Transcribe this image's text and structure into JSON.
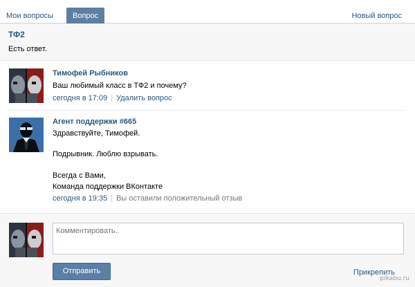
{
  "tabs": {
    "my_questions": "Мои вопросы",
    "question": "Вопрос",
    "new_question": "Новый вопрос"
  },
  "question": {
    "title": "ТФ2",
    "status": "Есть ответ."
  },
  "messages": [
    {
      "author": "Тимофей Рыбников",
      "text": "Ваш любимый класс в ТФ2 и почему?",
      "time": "сегодня в 17:09",
      "separator": "|",
      "action": "Удалить вопрос"
    },
    {
      "author": "Агент поддержки #665",
      "lines": [
        "Здравствуйте, Тимофей.",
        "Подрывник. Люблю взрывать.",
        "Всегда с Вами,",
        "Команда поддержки ВКонтакте"
      ],
      "time": "сегодня в 19:35",
      "separator": "|",
      "rating_note": "Вы оставили положительный отзыв"
    }
  ],
  "composer": {
    "placeholder": "Комментировать..",
    "send_label": "Отправить",
    "attach_label": "Прикрепить"
  },
  "watermark": "pikabu.ru",
  "colors": {
    "link": "#2b587a",
    "active_tab": "#5d7fa3",
    "button": "#5b7fa6",
    "header_bg": "#f7f7f7"
  }
}
